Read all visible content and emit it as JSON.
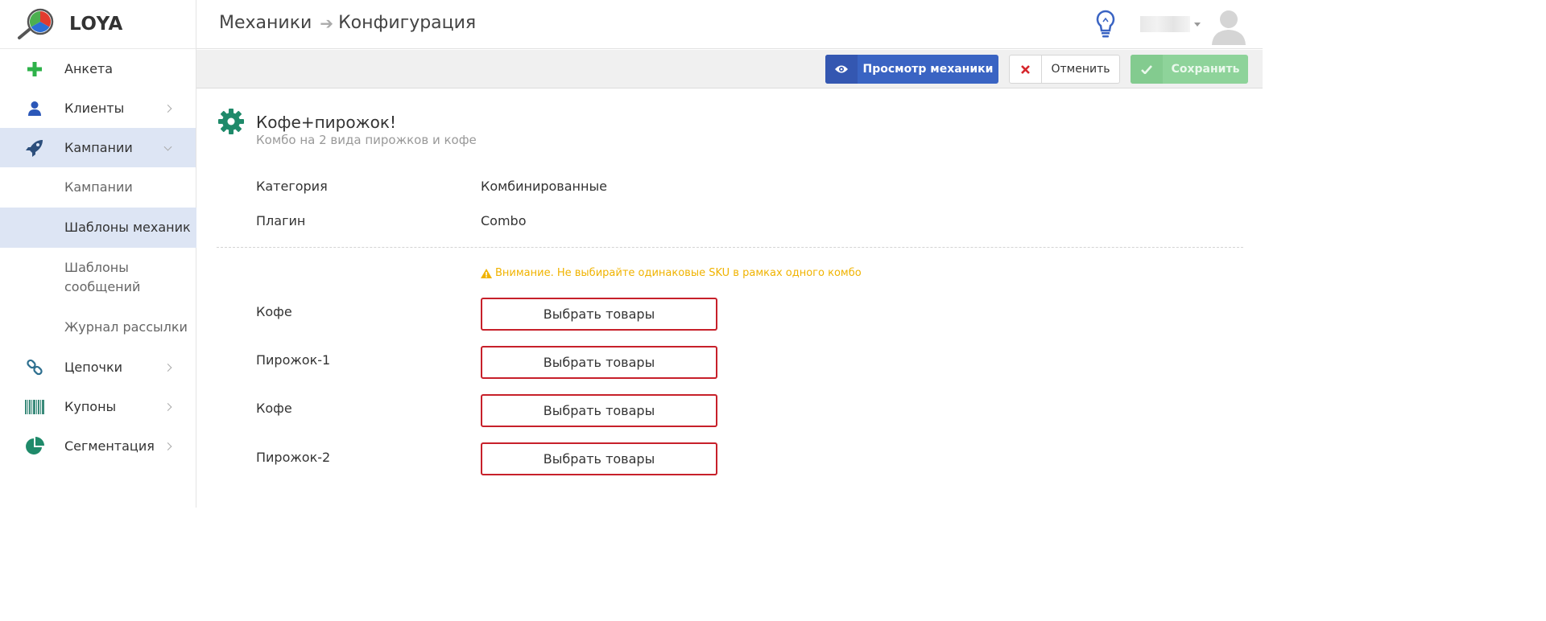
{
  "app": {
    "logo_text": "LOYA"
  },
  "sidebar": {
    "items": [
      {
        "label": "Анкета"
      },
      {
        "label": "Клиенты"
      },
      {
        "label": "Кампании"
      },
      {
        "label": "Цепочки"
      },
      {
        "label": "Купоны"
      },
      {
        "label": "Сегментация"
      }
    ],
    "campaign_subitems": [
      {
        "label": "Кампании"
      },
      {
        "label": "Шаблоны механик"
      },
      {
        "label": "Шаблоны сообщений"
      },
      {
        "label": "Журнал рассылки"
      }
    ],
    "active_item": "Кампании",
    "active_subitem": "Шаблоны механик"
  },
  "header": {
    "breadcrumb": [
      "Механики",
      "Конфигурация"
    ]
  },
  "toolbar": {
    "view_label": "Просмотр механики",
    "cancel_label": "Отменить",
    "save_label": "Сохранить"
  },
  "mechanic": {
    "title": "Кофе+пирожок!",
    "subtitle": "Комбо на 2 вида пирожков и кофе",
    "properties": [
      {
        "label": "Категория",
        "value": "Комбинированные"
      },
      {
        "label": "Плагин",
        "value": "Combo"
      }
    ],
    "warning": "Внимание. Не выбирайте одинаковые SKU в рамках одного комбо",
    "slots": [
      {
        "label": "Кофе",
        "button": "Выбрать товары"
      },
      {
        "label": "Пирожок-1",
        "button": "Выбрать товары"
      },
      {
        "label": "Кофе",
        "button": "Выбрать товары"
      },
      {
        "label": "Пирожок-2",
        "button": "Выбрать товары"
      }
    ]
  },
  "colors": {
    "primary": "#3a64c3",
    "success": "#8ed39a",
    "danger": "#c7202a",
    "warning": "#f0b300",
    "active_bg": "#dde5f4"
  }
}
